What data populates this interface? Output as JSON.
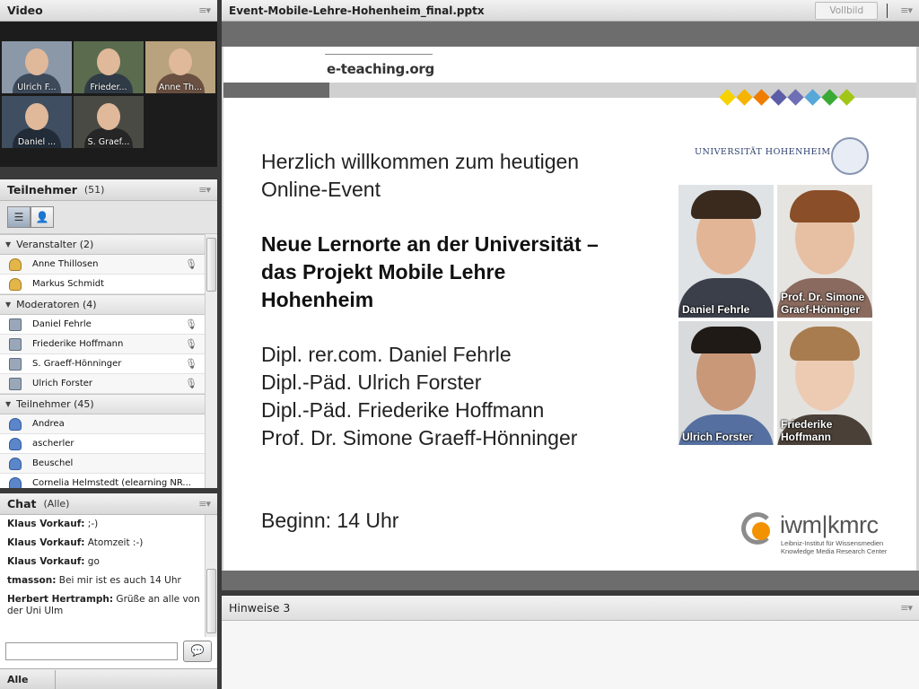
{
  "video": {
    "title": "Video",
    "tiles": [
      {
        "name": "Ulrich F..."
      },
      {
        "name": "Frieder..."
      },
      {
        "name": "Anne Th..."
      },
      {
        "name": "Daniel ..."
      },
      {
        "name": "S. Graef..."
      }
    ]
  },
  "participants": {
    "title": "Teilnehmer",
    "count": "(51)",
    "groups": [
      {
        "label": "Veranstalter (2)",
        "items": [
          "Anne Thillosen",
          "Markus Schmidt"
        ]
      },
      {
        "label": "Moderatoren (4)",
        "items": [
          "Daniel Fehrle",
          "Friederike Hoffmann",
          "S. Graeff-Hönninger",
          "Ulrich Forster"
        ]
      },
      {
        "label": "Teilnehmer (45)",
        "items": [
          "Andrea",
          "ascherler",
          "Beuschel",
          "Cornelia Helmstedt (elearning NR..."
        ]
      }
    ]
  },
  "chat": {
    "title": "Chat",
    "scope": "(Alle)",
    "messages": [
      {
        "sender": "Klaus Vorkauf:",
        "text": " ;-)"
      },
      {
        "sender": "Klaus Vorkauf:",
        "text": " Atomzeit :-)"
      },
      {
        "sender": "Klaus Vorkauf:",
        "text": " go"
      },
      {
        "sender": "tmasson:",
        "text": " Bei mir ist es auch 14 Uhr"
      },
      {
        "sender": "Herbert Hertramph:",
        "text": " Grüße an alle von der Uni Ulm"
      }
    ],
    "input_value": "",
    "tab_label": "Alle"
  },
  "share": {
    "title": "Event-Mobile-Lehre-Hohenheim_final.pptx",
    "fullscreen_label": "Vollbild"
  },
  "slide": {
    "logo": "e-teaching.org",
    "welcome_line1": "Herzlich willkommen zum heutigen",
    "welcome_line2": "Online-Event",
    "title_line1": "Neue Lernorte an der Universität –",
    "title_line2": "das Projekt Mobile Lehre",
    "title_line3": "Hohenheim",
    "speakers": [
      "Dipl. rer.com. Daniel Fehrle",
      "Dipl.-Päd. Ulrich Forster",
      "Dipl.-Päd. Friederike Hoffmann",
      "Prof. Dr. Simone Graeff-Hönninger"
    ],
    "start": "Beginn: 14 Uhr",
    "university": "UNIVERSITÄT HOHENHEIM",
    "photos": [
      {
        "line1": "Daniel Fehrle",
        "line2": ""
      },
      {
        "line1": "Prof. Dr. Simone",
        "line2": "Graef-Hönniger"
      },
      {
        "line1": "Ulrich Forster",
        "line2": ""
      },
      {
        "line1": "Friederike",
        "line2": "Hoffmann"
      }
    ],
    "diamond_colors": [
      "#f5d200",
      "#f5b400",
      "#ef7d00",
      "#5b5ea6",
      "#6f6fb5",
      "#56a8d8",
      "#3aaa35",
      "#a2c617"
    ],
    "iwm_brand": "iwm|kmrc",
    "iwm_sub1": "Leibniz-Institut für Wissensmedien",
    "iwm_sub2": "Knowledge Media Research Center"
  },
  "notes": {
    "title": "Hinweise 3"
  }
}
